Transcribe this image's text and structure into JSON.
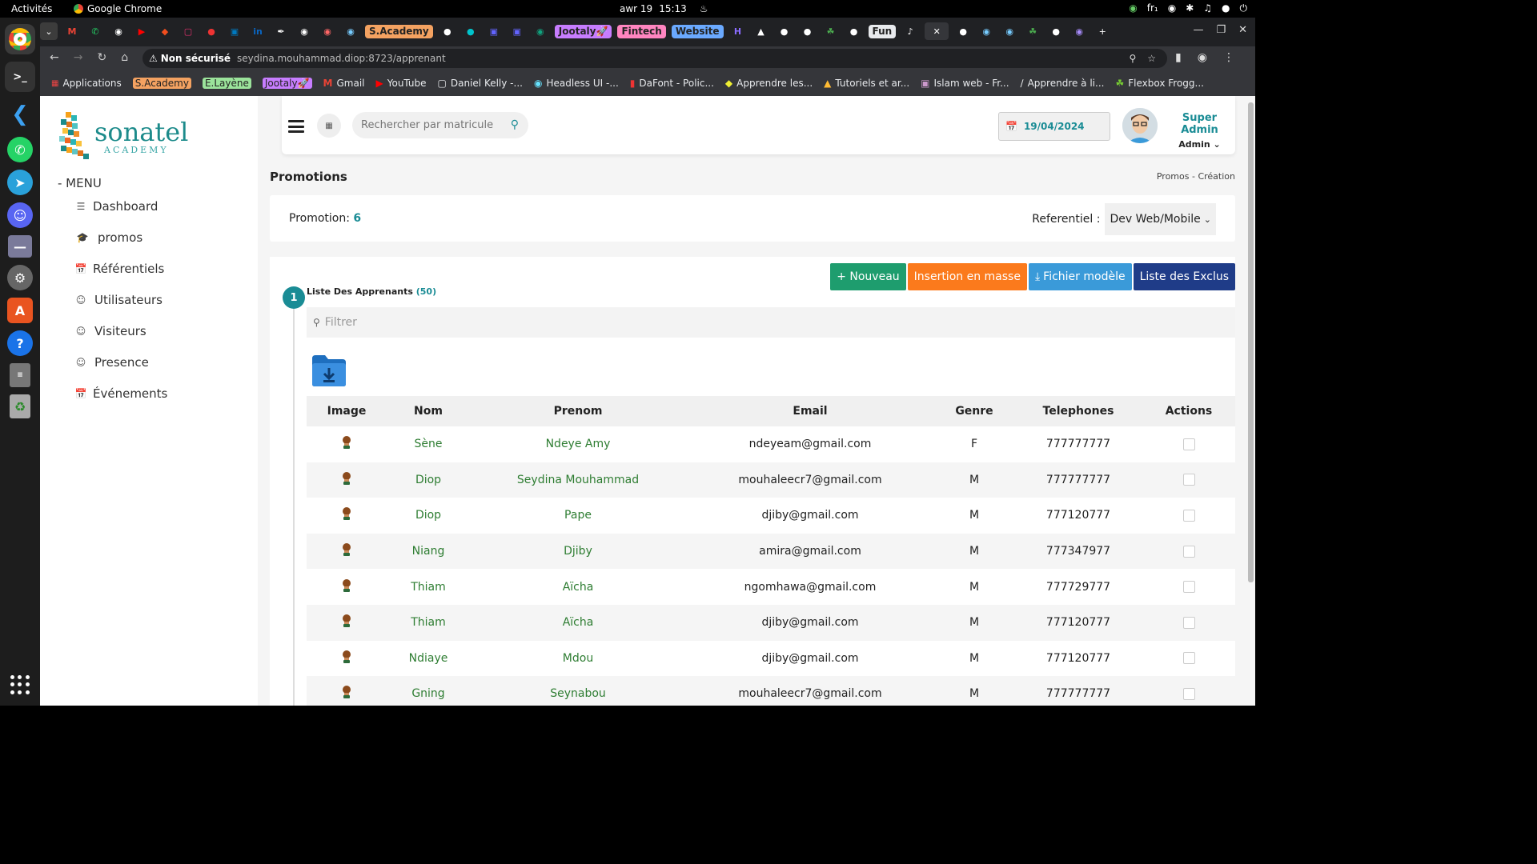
{
  "os": {
    "activities": "Activités",
    "app_name": "Google Chrome",
    "date": "awr 19",
    "time": "15:13",
    "lang": "fr₁"
  },
  "browser": {
    "tab_labels": [
      "S.Academy",
      "Jootaly🚀",
      "Fintech",
      "Website",
      "Fun"
    ],
    "tab_label_colors": [
      "#f4a261",
      "#c77dff",
      "#ff85c0",
      "#6aa9ff",
      "#ffffff"
    ],
    "not_secure": "Non sécurisé",
    "url": "seydina.mouhammad.diop:8723/apprenant",
    "bookmarks": [
      "Applications",
      "S.Academy",
      "E.Layène",
      "Jootaly🚀",
      "Gmail",
      "YouTube",
      "Daniel Kelly -...",
      "Headless UI -...",
      "DaFont - Polic...",
      "Apprendre les...",
      "Tutoriels et ar...",
      "Islam web - Fr...",
      "Apprendre à li...",
      "Flexbox Frogg..."
    ]
  },
  "sidebar": {
    "logo_name": "sonatel",
    "logo_sub": "ACADEMY",
    "menu_title": "- MENU",
    "items": [
      {
        "label": "Dashboard",
        "icon": "list-icon"
      },
      {
        "label": "promos",
        "icon": "graduation-cap-icon"
      },
      {
        "label": "Référentiels",
        "icon": "calendar-plus-icon"
      },
      {
        "label": "Utilisateurs",
        "icon": "user-circle-icon"
      },
      {
        "label": "Visiteurs",
        "icon": "user-circle-icon"
      },
      {
        "label": "Presence",
        "icon": "user-circle-icon"
      },
      {
        "label": "Événements",
        "icon": "calendar-plus-icon"
      }
    ]
  },
  "header": {
    "search_placeholder": "Rechercher par matricule",
    "date": "19/04/2024",
    "user_name": "Super Admin",
    "user_role": "Admin"
  },
  "page": {
    "title": "Promotions",
    "breadcrumb": "Promos - Création",
    "promotion_label": "Promotion:",
    "promotion_value": "6",
    "referentiel_label": "Referentiel :",
    "referentiel_value": "Dev Web/Mobile"
  },
  "actions": {
    "new": "+ Nouveau",
    "bulk": "Insertion en masse",
    "template": "Fichier modèle",
    "excluded": "Liste des Exclus"
  },
  "list": {
    "step": "1",
    "title": "Liste Des Apprenants",
    "count": "(50)",
    "filter_placeholder": "Filtrer",
    "columns": [
      "Image",
      "Nom",
      "Prenom",
      "Email",
      "Genre",
      "Telephones",
      "Actions"
    ],
    "rows": [
      {
        "nom": "Sène",
        "prenom": "Ndeye Amy",
        "email": "ndeyeam@gmail.com",
        "genre": "F",
        "tel": "777777777"
      },
      {
        "nom": "Diop",
        "prenom": "Seydina Mouhammad",
        "email": "mouhaleecr7@gmail.com",
        "genre": "M",
        "tel": "777777777"
      },
      {
        "nom": "Diop",
        "prenom": "Pape",
        "email": "djiby@gmail.com",
        "genre": "M",
        "tel": "777120777"
      },
      {
        "nom": "Niang",
        "prenom": "Djiby",
        "email": "amira@gmail.com",
        "genre": "M",
        "tel": "777347977"
      },
      {
        "nom": "Thiam",
        "prenom": "Aïcha",
        "email": "ngomhawa@gmail.com",
        "genre": "M",
        "tel": "777729777"
      },
      {
        "nom": "Thiam",
        "prenom": "Aïcha",
        "email": "djiby@gmail.com",
        "genre": "M",
        "tel": "777120777"
      },
      {
        "nom": "Ndiaye",
        "prenom": "Mdou",
        "email": "djiby@gmail.com",
        "genre": "M",
        "tel": "777120777"
      },
      {
        "nom": "Gning",
        "prenom": "Seynabou",
        "email": "mouhaleecr7@gmail.com",
        "genre": "M",
        "tel": "777777777"
      }
    ]
  },
  "colors": {
    "accent": "#1a8c95",
    "green_btn": "#1e9d6e",
    "orange_btn": "#fb7a1c",
    "blue_btn": "#3a9ad9",
    "navy_btn": "#1f3c88",
    "name_green": "#2e7d32"
  }
}
